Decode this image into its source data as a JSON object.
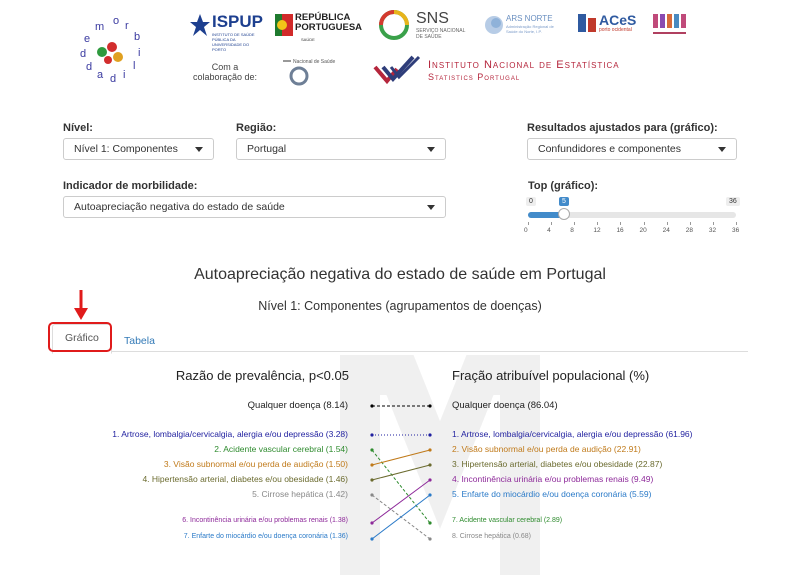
{
  "header": {
    "logo_letters": [
      "d",
      "e",
      "m",
      "o",
      "r",
      "b",
      "i",
      "l",
      "i",
      "d",
      "a",
      "d",
      "e"
    ],
    "ispup": {
      "name": "ISPUP",
      "tag": "INSTITUTO DE SAÚDE PÚBLICA DA UNIVERSIDADE DO PORTO"
    },
    "republica": {
      "name": "REPÚBLICA PORTUGUESA",
      "sub": "SAÚDE"
    },
    "sns": {
      "name": "SNS",
      "sub": "SERVIÇO NACIONAL DE SAÚDE"
    },
    "ars": {
      "name": "ARS NORTE",
      "sub": "Administração Regional de Saúde do Norte, I.P."
    },
    "aces": {
      "name": "ACeS",
      "sub": "porto ocidental"
    },
    "collab_label": "Com a colaboração de:",
    "ine": {
      "line1": "Instituto Nacional de Estatística",
      "line2": "Statistics Portugal"
    }
  },
  "filters": {
    "nivel": {
      "label": "Nível:",
      "value": "Nível 1: Componentes"
    },
    "regiao": {
      "label": "Região:",
      "value": "Portugal"
    },
    "resultados": {
      "label": "Resultados ajustados para (gráfico):",
      "value": "Confundidores e componentes"
    },
    "indicador": {
      "label": "Indicador de morbilidade:",
      "value": "Autoapreciação negativa do estado de saúde"
    },
    "top": {
      "label": "Top (gráfico):",
      "min": "0",
      "max": "36",
      "value": "5",
      "value_num": 5,
      "ticks": [
        "0",
        "4",
        "8",
        "12",
        "16",
        "20",
        "24",
        "28",
        "32",
        "36"
      ]
    }
  },
  "title": "Autoapreciação negativa do estado de saúde em Portugal",
  "subtitle": "Nível 1: Componentes (agrupamentos de doenças)",
  "tabs": {
    "grafico": "Gráfico",
    "tabela": "Tabela"
  },
  "chart": {
    "left_title": "Razão de prevalência, p<0.05",
    "right_title": "Fração atribuível populacional (%)",
    "left_any": "Qualquer doença (8.14)",
    "right_any": "Qualquer doença (86.04)",
    "left_items": [
      {
        "text": "1. Artrose, lombalgia/cervicalgia, alergia e/ou depressão (3.28)",
        "color": "#1f1f9f"
      },
      {
        "text": "2. Acidente vascular cerebral (1.54)",
        "color": "#2e8b2e"
      },
      {
        "text": "3. Visão subnormal e/ou perda de audição (1.50)",
        "color": "#c07a1a"
      },
      {
        "text": "4. Hipertensão arterial, diabetes e/ou obesidade (1.46)",
        "color": "#6b6b2f"
      },
      {
        "text": "5. Cirrose hepática (1.42)",
        "color": "#888888"
      },
      {
        "text": "6. Incontinência urinária e/ou problemas renais (1.38)",
        "color": "#8e2a9a"
      },
      {
        "text": "7. Enfarte do miocárdio e/ou doença coronária (1.36)",
        "color": "#2a7ac8"
      }
    ],
    "right_items": [
      {
        "text": "1. Artrose, lombalgia/cervicalgia, alergia e/ou depressão (61.96)",
        "color": "#1f1f9f"
      },
      {
        "text": "2. Visão subnormal e/ou perda de audição (22.91)",
        "color": "#c07a1a"
      },
      {
        "text": "3. Hipertensão arterial, diabetes e/ou obesidade (22.87)",
        "color": "#6b6b2f"
      },
      {
        "text": "4. Incontinência urinária e/ou problemas renais (9.49)",
        "color": "#8e2a9a"
      },
      {
        "text": "5. Enfarte do miocárdio e/ou doença coronária (5.59)",
        "color": "#2a7ac8"
      },
      {
        "text": "7. Acidente vascular cerebral (2.89)",
        "color": "#2e8b2e"
      },
      {
        "text": "8. Cirrose hepática (0.68)",
        "color": "#888888"
      }
    ]
  }
}
